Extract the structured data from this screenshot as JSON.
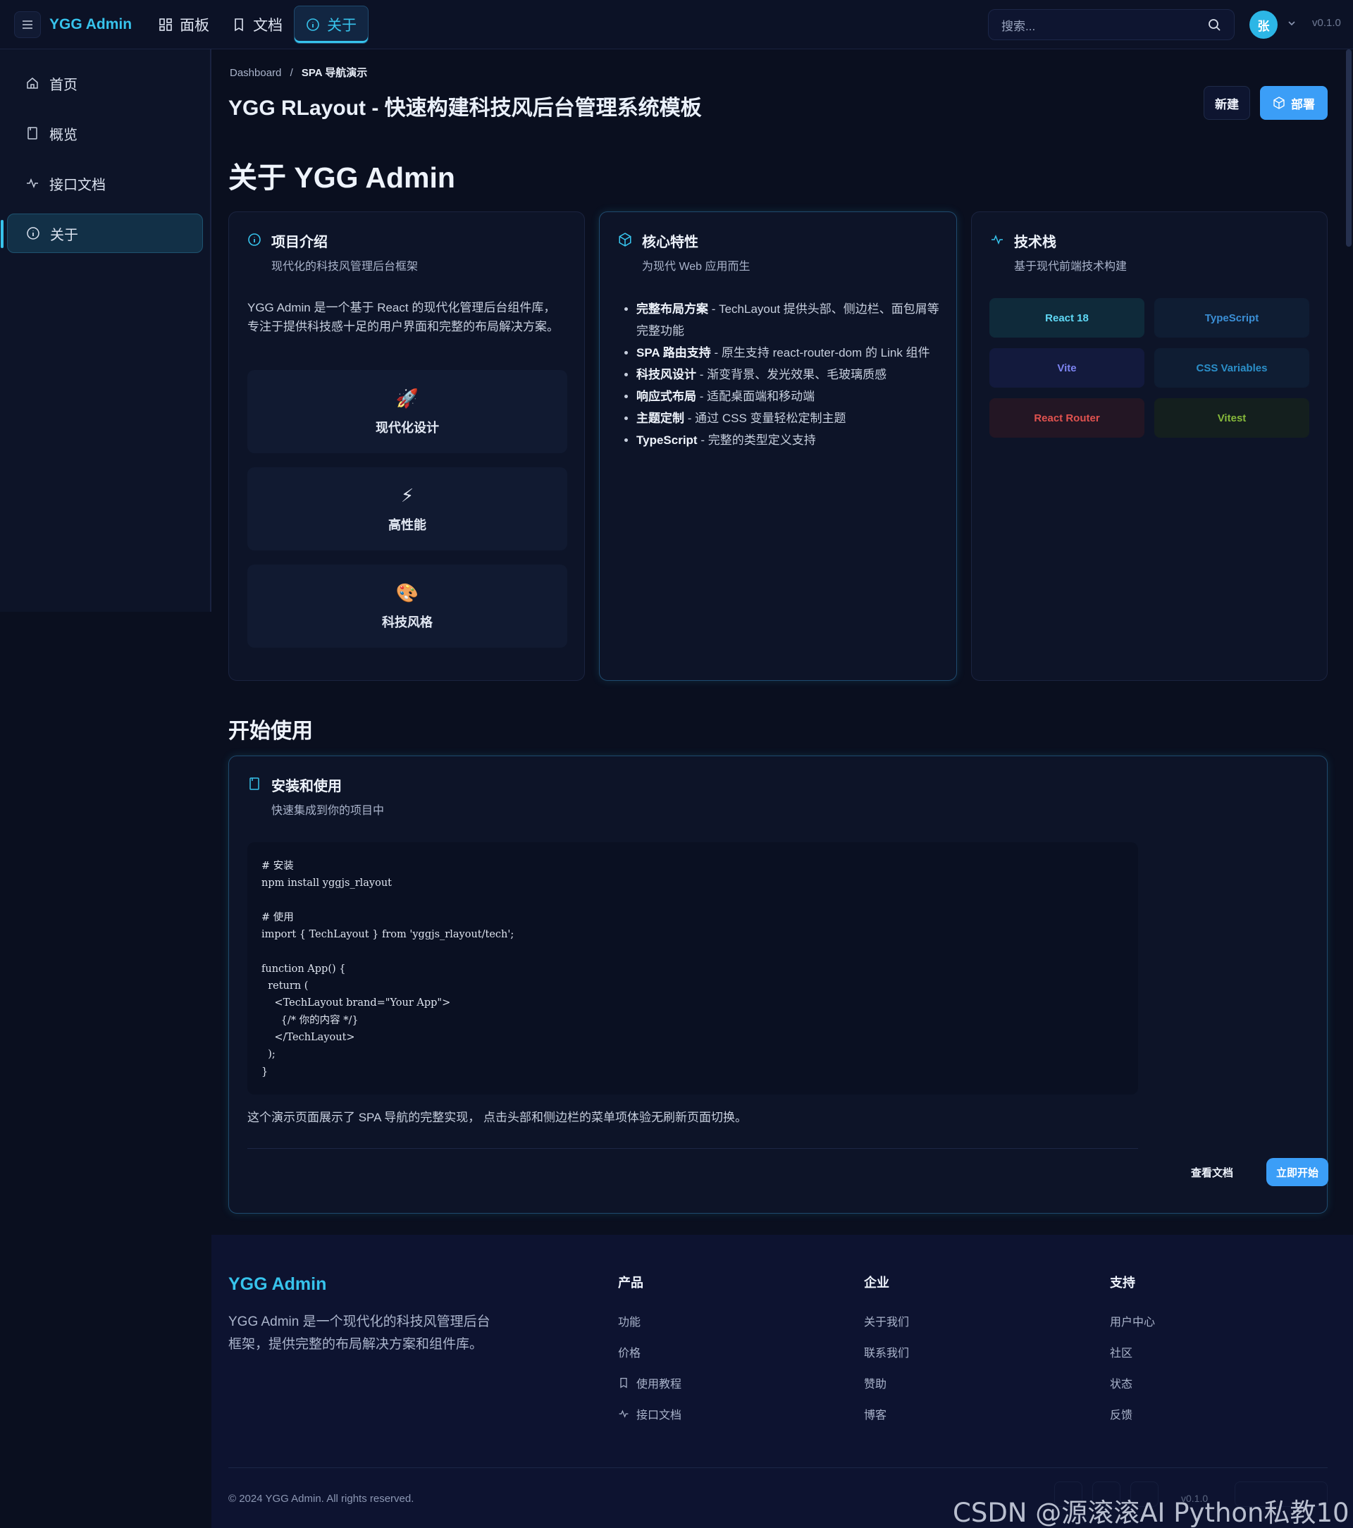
{
  "header": {
    "brand": "YGG Admin",
    "nav": [
      {
        "label": "面板",
        "icon": "dashboard-icon"
      },
      {
        "label": "文档",
        "icon": "document-icon"
      },
      {
        "label": "关于",
        "icon": "info-icon",
        "active": true
      }
    ],
    "search_placeholder": "搜索...",
    "avatar_initial": "张",
    "version": "v0.1.0"
  },
  "sidebar": {
    "items": [
      {
        "label": "首页",
        "icon": "home-icon"
      },
      {
        "label": "概览",
        "icon": "document-icon"
      },
      {
        "label": "接口文档",
        "icon": "activity-icon"
      },
      {
        "label": "关于",
        "icon": "info-icon",
        "active": true
      }
    ]
  },
  "page": {
    "breadcrumb_root": "Dashboard",
    "breadcrumb_sep": "/",
    "breadcrumb_current": "SPA 导航演示",
    "title": "YGG RLayout - 快速构建科技风后台管理系统模板",
    "new_label": "新建",
    "deploy_label": "部署",
    "heading": "关于 YGG Admin"
  },
  "intro_card": {
    "title": "项目介绍",
    "subtitle": "现代化的科技风管理后台框架",
    "text": "YGG Admin 是一个基于 React 的现代化管理后台组件库，专注于提供科技感十足的用户界面和完整的布局解决方案。",
    "features": [
      {
        "emoji": "🚀",
        "label": "现代化设计"
      },
      {
        "emoji": "⚡",
        "label": "高性能"
      },
      {
        "emoji": "🎨",
        "label": "科技风格"
      }
    ]
  },
  "core_card": {
    "title": "核心特性",
    "subtitle": "为现代 Web 应用而生",
    "items": [
      {
        "bold": "完整布局方案",
        "text": " - TechLayout 提供头部、侧边栏、面包屑等完整功能"
      },
      {
        "bold": "SPA 路由支持",
        "text": " - 原生支持 react-router-dom 的 Link 组件"
      },
      {
        "bold": "科技风设计",
        "text": " - 渐变背景、发光效果、毛玻璃质感"
      },
      {
        "bold": "响应式布局",
        "text": " - 适配桌面端和移动端"
      },
      {
        "bold": "主题定制",
        "text": " - 通过 CSS 变量轻松定制主题"
      },
      {
        "bold": "TypeScript",
        "text": " - 完整的类型定义支持"
      }
    ]
  },
  "tech_card": {
    "title": "技术栈",
    "subtitle": "基于现代前端技术构建",
    "tags": [
      {
        "label": "React 18",
        "color": "#5fd8f5",
        "bg": "#0f2a3a"
      },
      {
        "label": "TypeScript",
        "color": "#3b8fd6",
        "bg": "#0f1d33"
      },
      {
        "label": "Vite",
        "color": "#7c83f0",
        "bg": "#131a3d"
      },
      {
        "label": "CSS Variables",
        "color": "#2b8fc9",
        "bg": "#0f1d33"
      },
      {
        "label": "React Router",
        "color": "#e0524f",
        "bg": "#231624"
      },
      {
        "label": "Vitest",
        "color": "#86b93b",
        "bg": "#141f1e"
      }
    ]
  },
  "getting_started": {
    "heading": "开始使用",
    "title": "安装和使用",
    "subtitle": "快速集成到你的项目中",
    "code": "# 安装\nnpm install yggjs_rlayout\n\n# 使用\nimport { TechLayout } from 'yggjs_rlayout/tech';\n\nfunction App() {\n  return (\n    <TechLayout brand=\"Your App\">\n      {/* 你的内容 */}\n    </TechLayout>\n  );\n}",
    "note": "这个演示页面展示了 SPA 导航的完整实现， 点击头部和侧边栏的菜单项体验无刷新页面切换。",
    "docs_label": "查看文档",
    "start_label": "立即开始"
  },
  "footer": {
    "brand": "YGG Admin",
    "description": "YGG Admin 是一个现代化的科技风管理后台框架，提供完整的布局解决方案和组件库。",
    "columns": [
      {
        "title": "产品",
        "links": [
          {
            "label": "功能",
            "icon": ""
          },
          {
            "label": "价格",
            "icon": ""
          },
          {
            "label": "使用教程",
            "icon": "book-icon"
          },
          {
            "label": "接口文档",
            "icon": "activity-icon"
          }
        ]
      },
      {
        "title": "企业",
        "links": [
          {
            "label": "关于我们"
          },
          {
            "label": "联系我们"
          },
          {
            "label": "赞助"
          },
          {
            "label": "博客"
          }
        ]
      },
      {
        "title": "支持",
        "links": [
          {
            "label": "用户中心"
          },
          {
            "label": "社区"
          },
          {
            "label": "状态"
          },
          {
            "label": "反馈"
          }
        ]
      }
    ],
    "copyright": "© 2024 YGG Admin. All rights reserved.",
    "version": "v0.1.0"
  },
  "watermark": "CSDN @源滚滚AI Python私教10年",
  "colors": {
    "accent": "#37c3ec",
    "primary_button": "#3b9ef7",
    "background": "#0a0f1f"
  }
}
